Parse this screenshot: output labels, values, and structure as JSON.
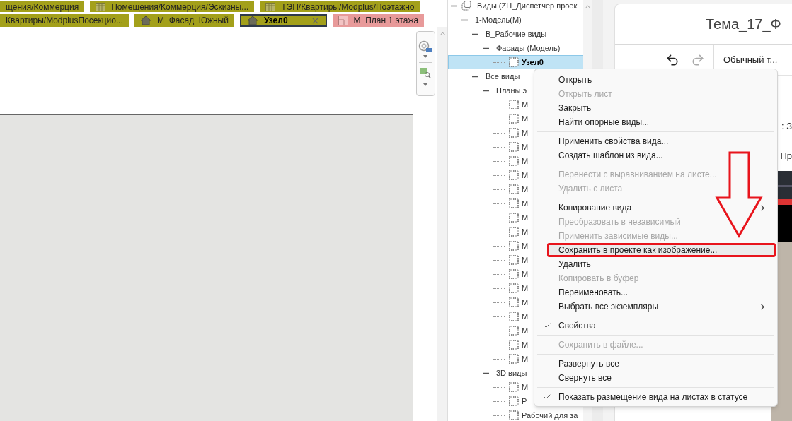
{
  "tab_rows": [
    [
      {
        "label": "щения/Коммерция",
        "kind": "cut",
        "selected": false,
        "color": "#a3a01a"
      },
      {
        "label": "Помещения/Коммерция/Эскизны...",
        "kind": "schedule",
        "selected": false,
        "color": "#a3a01a"
      },
      {
        "label": "ТЭП/Квартиры/Modplus/Поэтажно",
        "kind": "schedule",
        "selected": false,
        "color": "#a3a01a"
      }
    ],
    [
      {
        "label": "Квартиры/ModplusПосекцио...",
        "kind": "cut",
        "selected": false,
        "color": "#a3a01a"
      },
      {
        "label": "М_Фасад_Южный",
        "kind": "elevation",
        "selected": false,
        "color": "#a3a01a"
      },
      {
        "label": "Узел0",
        "kind": "elevation",
        "selected": true,
        "color": "#a3a01a"
      },
      {
        "label": "М_План 1 этажа",
        "kind": "plan",
        "selected": false,
        "color": "#e89a9a"
      }
    ]
  ],
  "project_browser": {
    "tree": [
      {
        "label": "Виды (ZH_Диспетчер проек",
        "kind": "root",
        "expanded": true,
        "selected": false,
        "children": [
          {
            "label": "1-Модель(М)",
            "kind": "group",
            "expanded": true,
            "selected": false,
            "children": [
              {
                "label": "В_Рабочие виды",
                "kind": "group",
                "expanded": true,
                "selected": false,
                "children": [
                  {
                    "label": "Фасады (Модель)",
                    "kind": "group",
                    "expanded": true,
                    "selected": false,
                    "children": [
                      {
                        "label": "Узел0",
                        "kind": "view",
                        "selected": true
                      }
                    ]
                  }
                ]
              },
              {
                "label": "Все виды",
                "kind": "group",
                "expanded": true,
                "selected": false,
                "children": [
                  {
                    "label": "Планы э",
                    "kind": "group",
                    "expanded": true,
                    "selected": false,
                    "children": [
                      {
                        "label": "М",
                        "kind": "view",
                        "selected": false
                      },
                      {
                        "label": "М",
                        "kind": "view",
                        "selected": false
                      },
                      {
                        "label": "М",
                        "kind": "view",
                        "selected": false
                      },
                      {
                        "label": "М",
                        "kind": "view",
                        "selected": false
                      },
                      {
                        "label": "М",
                        "kind": "view",
                        "selected": false
                      },
                      {
                        "label": "М",
                        "kind": "view",
                        "selected": false
                      },
                      {
                        "label": "М",
                        "kind": "view",
                        "selected": false
                      },
                      {
                        "label": "М",
                        "kind": "view",
                        "selected": false
                      },
                      {
                        "label": "М",
                        "kind": "view",
                        "selected": false
                      },
                      {
                        "label": "М",
                        "kind": "view",
                        "selected": false
                      },
                      {
                        "label": "М",
                        "kind": "view",
                        "selected": false
                      },
                      {
                        "label": "М",
                        "kind": "view",
                        "selected": false
                      },
                      {
                        "label": "М",
                        "kind": "view",
                        "selected": false
                      },
                      {
                        "label": "М",
                        "kind": "view",
                        "selected": false
                      },
                      {
                        "label": "М",
                        "kind": "view",
                        "selected": false
                      },
                      {
                        "label": "М",
                        "kind": "view",
                        "selected": false
                      },
                      {
                        "label": "М",
                        "kind": "view",
                        "selected": false
                      },
                      {
                        "label": "М",
                        "kind": "view",
                        "selected": false
                      },
                      {
                        "label": "М",
                        "kind": "view",
                        "selected": false
                      }
                    ]
                  },
                  {
                    "label": "3D виды",
                    "kind": "group",
                    "expanded": true,
                    "selected": false,
                    "children": [
                      {
                        "label": "М",
                        "kind": "view",
                        "selected": false
                      },
                      {
                        "label": "Р",
                        "kind": "view",
                        "selected": false
                      },
                      {
                        "label": "Рабочий для за",
                        "kind": "view",
                        "selected": false
                      }
                    ]
                  }
                ]
              }
            ]
          }
        ]
      }
    ]
  },
  "doc_panel": {
    "title": "Тема_17_Ф",
    "style_label": "Обычный т...",
    "fragments": [
      ": З",
      "Пр"
    ]
  },
  "context_menu": {
    "groups": [
      [
        {
          "label": "Открыть",
          "disabled": false,
          "checked": false,
          "submenu": false,
          "selected": false
        },
        {
          "label": "Открыть лист",
          "disabled": true,
          "checked": false,
          "submenu": false,
          "selected": false
        },
        {
          "label": "Закрыть",
          "disabled": false,
          "checked": false,
          "submenu": false,
          "selected": false
        },
        {
          "label": "Найти опорные виды...",
          "disabled": false,
          "checked": false,
          "submenu": false,
          "selected": false
        }
      ],
      [
        {
          "label": "Применить свойства вида...",
          "disabled": false,
          "checked": false,
          "submenu": false,
          "selected": false
        },
        {
          "label": "Создать шаблон из вида...",
          "disabled": false,
          "checked": false,
          "submenu": false,
          "selected": false
        }
      ],
      [
        {
          "label": "Перенести с выравниванием на листе...",
          "disabled": true,
          "checked": false,
          "submenu": false,
          "selected": false
        },
        {
          "label": "Удалить с листа",
          "disabled": true,
          "checked": false,
          "submenu": false,
          "selected": false
        }
      ],
      [
        {
          "label": "Копирование вида",
          "disabled": false,
          "checked": false,
          "submenu": true,
          "selected": false
        },
        {
          "label": "Преобразовать в независимый",
          "disabled": true,
          "checked": false,
          "submenu": false,
          "selected": false
        },
        {
          "label": "Применить зависимые виды...",
          "disabled": true,
          "checked": false,
          "submenu": false,
          "selected": false
        },
        {
          "label": "Сохранить в проекте как изображение...",
          "disabled": false,
          "checked": false,
          "submenu": false,
          "selected": true,
          "highlight_frame": true
        },
        {
          "label": "Удалить",
          "disabled": false,
          "checked": false,
          "submenu": false,
          "selected": false
        },
        {
          "label": "Копировать в буфер",
          "disabled": true,
          "checked": false,
          "submenu": false,
          "selected": false
        },
        {
          "label": "Переименовать...",
          "disabled": false,
          "checked": false,
          "submenu": false,
          "selected": false
        },
        {
          "label": "Выбрать все экземпляры",
          "disabled": false,
          "checked": false,
          "submenu": true,
          "selected": false
        }
      ],
      [
        {
          "label": "Свойства",
          "disabled": false,
          "checked": true,
          "submenu": false,
          "selected": false
        }
      ],
      [
        {
          "label": "Сохранить в файле...",
          "disabled": true,
          "checked": false,
          "submenu": false,
          "selected": false
        }
      ],
      [
        {
          "label": "Развернуть все",
          "disabled": false,
          "checked": false,
          "submenu": false,
          "selected": false
        },
        {
          "label": "Свернуть все",
          "disabled": false,
          "checked": false,
          "submenu": false,
          "selected": false
        }
      ],
      [
        {
          "label": "Показать размещение вида на листах в статусе",
          "disabled": false,
          "checked": true,
          "submenu": false,
          "selected": false
        }
      ]
    ]
  }
}
